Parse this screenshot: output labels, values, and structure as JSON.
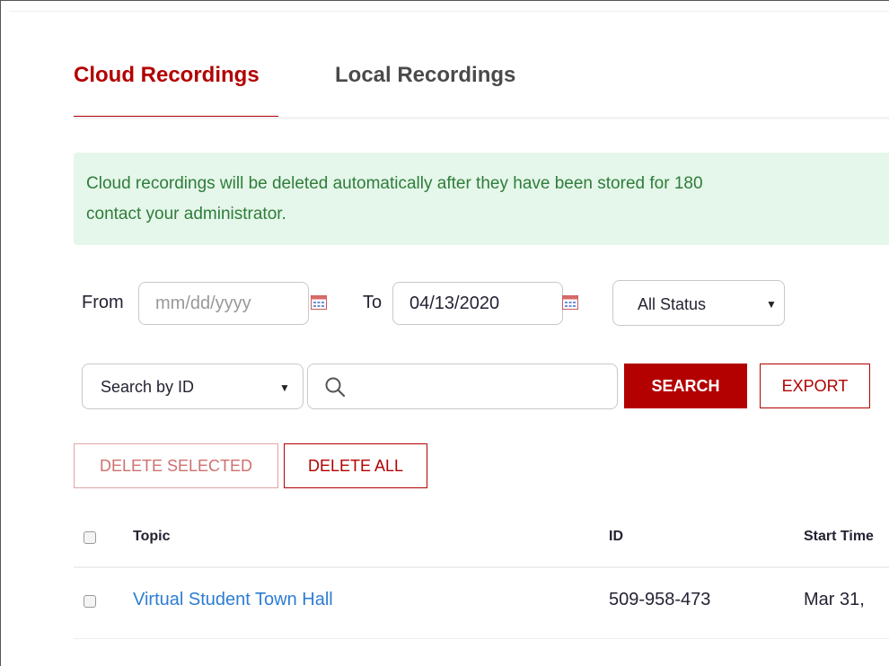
{
  "tabs": [
    {
      "label": "Cloud Recordings",
      "active": true
    },
    {
      "label": "Local Recordings",
      "active": false
    }
  ],
  "notice": {
    "line1": "Cloud recordings will be deleted automatically after they have been stored for 180",
    "line2": "contact your administrator."
  },
  "filters": {
    "from_label": "From",
    "from_placeholder": "mm/dd/yyyy",
    "to_label": "To",
    "to_value": "04/13/2020",
    "status_value": "All Status"
  },
  "search": {
    "type_value": "Search by ID",
    "search_label": "SEARCH",
    "export_label": "EXPORT"
  },
  "actions": {
    "delete_selected_label": "DELETE SELECTED",
    "delete_all_label": "DELETE ALL"
  },
  "table": {
    "headers": {
      "topic": "Topic",
      "id": "ID",
      "start_time": "Start Time"
    },
    "rows": [
      {
        "topic": "Virtual Student Town Hall",
        "id": "509-958-473",
        "start_time": "Mar 31,"
      }
    ]
  },
  "colors": {
    "accent": "#b30000",
    "notice_bg": "#e5f6ea",
    "notice_text": "#2e7d3a",
    "link": "#2d7dd2"
  },
  "icons": [
    "calendar-icon",
    "search-icon",
    "chevron-down-icon",
    "caret-down-icon"
  ]
}
